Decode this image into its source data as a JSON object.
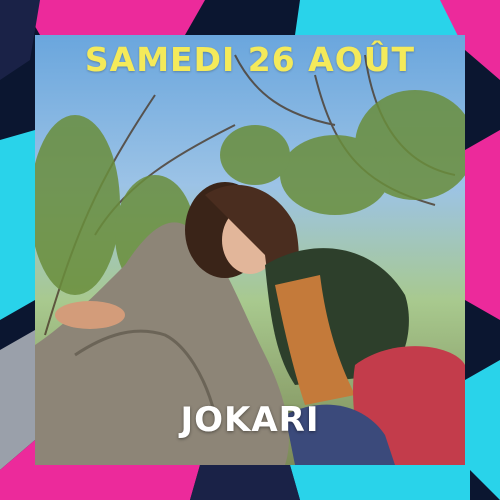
{
  "poster": {
    "date_label": "SAMEDI 26 AOÛT",
    "artist_name": "JOKARI"
  },
  "colors": {
    "date_text": "#f4ea5a",
    "artist_text": "#ffffff",
    "frame_navy": "#0b1630",
    "frame_magenta": "#ec2a9b",
    "frame_cyan": "#29d3ea"
  }
}
